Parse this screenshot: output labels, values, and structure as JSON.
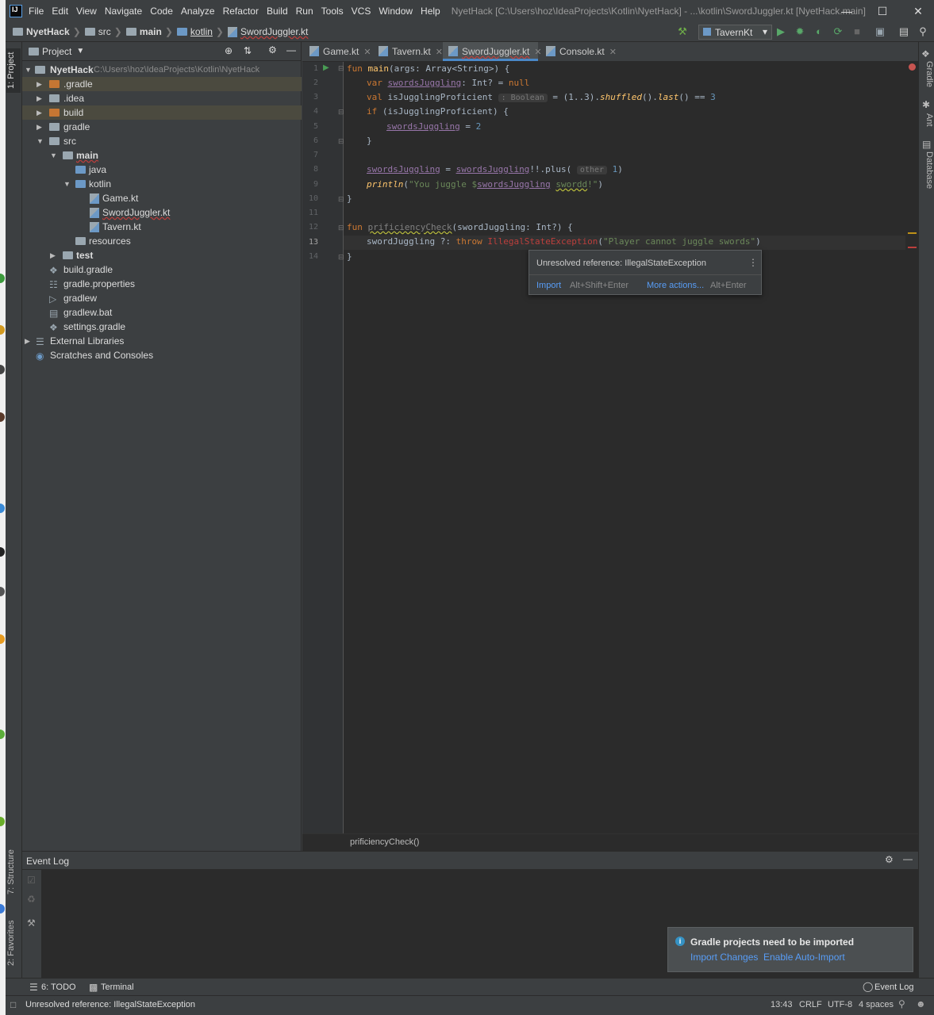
{
  "window": {
    "title": "NyetHack [C:\\Users\\hoz\\IdeaProjects\\Kotlin\\NyetHack] - ...\\kotlin\\SwordJuggler.kt [NyetHack.main]",
    "menu": [
      "File",
      "Edit",
      "View",
      "Navigate",
      "Code",
      "Analyze",
      "Refactor",
      "Build",
      "Run",
      "Tools",
      "VCS",
      "Window",
      "Help"
    ]
  },
  "breadcrumb": [
    "NyetHack",
    "src",
    "main",
    "kotlin",
    "SwordJuggler.kt"
  ],
  "run_config": "TavernKt",
  "left_strip": {
    "project_tab": "1: Project",
    "structure_tab": "7: Structure",
    "favorites_tab": "2: Favorites"
  },
  "right_strip": {
    "gradle": "Gradle",
    "ant": "Ant",
    "database": "Database"
  },
  "project_panel": {
    "header": "Project",
    "root_name": "NyetHack",
    "root_path": "C:\\Users\\hoz\\IdeaProjects\\Kotlin\\NyetHack",
    "items": [
      ".gradle",
      ".idea",
      "build",
      "gradle",
      "src",
      "main",
      "java",
      "kotlin",
      "Game.kt",
      "SwordJuggler.kt",
      "Tavern.kt",
      "resources",
      "test",
      "build.gradle",
      "gradle.properties",
      "gradlew",
      "gradlew.bat",
      "settings.gradle",
      "External Libraries",
      "Scratches and Consoles"
    ]
  },
  "tabs": [
    "Game.kt",
    "Tavern.kt",
    "SwordJuggler.kt",
    "Console.kt"
  ],
  "line_numbers": [
    "1",
    "2",
    "3",
    "4",
    "5",
    "6",
    "7",
    "8",
    "9",
    "10",
    "11",
    "12",
    "13",
    "14"
  ],
  "code": {
    "l1": {
      "fun": "fun ",
      "main": "main",
      "args": "(args: Array<String>) {"
    },
    "l2": {
      "var": "var ",
      "name": "swordsJuggling",
      "rest": ": Int? = ",
      "null": "null"
    },
    "l3": {
      "val": "val ",
      "name": "isJugglingProficient",
      "hint": ": Boolean",
      "rest": " = (1..3).",
      "shuffled": "shuffled",
      "mid": "().",
      "last": "last",
      "end": "() == ",
      "three": "3"
    },
    "l4": {
      "if": "if ",
      "rest": "(isJugglingProficient) {"
    },
    "l5": {
      "name": "swordsJuggling",
      "rest": " = ",
      "two": "2"
    },
    "l6": "}",
    "l8": {
      "a": "swordsJuggling",
      "eq": " = ",
      "b": "swordsJuggling",
      "rest": "!!.plus(",
      "hint": "other",
      "one": " 1",
      ")": ")"
    },
    "l9": {
      "println": "println",
      "open": "(",
      "s1": "\"You juggle $",
      "var": "swordsJuggling",
      "sp": " ",
      "typo": "swordd",
      "s2": "!\"",
      ")": ")"
    },
    "l10": "}",
    "l12": {
      "fun": "fun ",
      "name": "prificiencyCheck",
      "rest": "(swordJuggling: Int?) {"
    },
    "l13": {
      "a": "swordJuggling ?: ",
      "throw": "throw ",
      "err": "IllegalStateException",
      "open": "(",
      "msg": "\"Player cannot juggle swords\"",
      "close": ")"
    },
    "l14": "}"
  },
  "tooltip": {
    "message": "Unresolved reference: IllegalStateException",
    "import": "Import",
    "import_shortcut": "Alt+Shift+Enter",
    "more": "More actions...",
    "more_shortcut": "Alt+Enter"
  },
  "editor_breadcrumb": "prificiencyCheck()",
  "event_log": {
    "title": "Event Log"
  },
  "notification": {
    "title": "Gradle projects need to be imported",
    "import_changes": "Import Changes",
    "enable_auto": "Enable Auto-Import"
  },
  "bottom_tools": {
    "todo": "6: TODO",
    "terminal": "Terminal",
    "event_log": "Event Log"
  },
  "status": {
    "message": "Unresolved reference: IllegalStateException",
    "position": "13:43",
    "line_sep": "CRLF",
    "encoding": "UTF-8",
    "indent": "4 spaces"
  }
}
